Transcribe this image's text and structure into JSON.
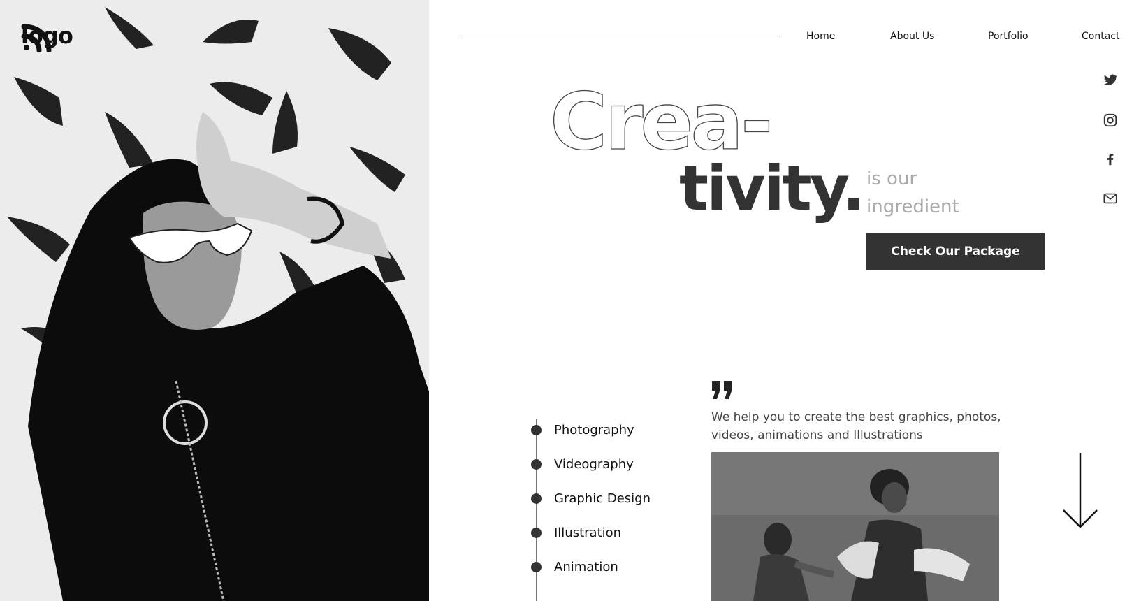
{
  "brand": {
    "logo_text": "logo"
  },
  "nav": {
    "items": [
      {
        "label": "Home"
      },
      {
        "label": "About Us"
      },
      {
        "label": "Portfolio"
      },
      {
        "label": "Contact"
      }
    ]
  },
  "social": [
    "twitter-icon",
    "instagram-icon",
    "facebook-icon",
    "mail-icon"
  ],
  "hero": {
    "word_part1": "Crea-",
    "word_part2": "tivity.",
    "tagline_line1": "is our",
    "tagline_line2": "ingredient",
    "cta_label": "Check Our Package"
  },
  "services": {
    "items": [
      "Photography",
      "Videography",
      "Graphic Design",
      "Illustration",
      "Animation"
    ]
  },
  "quote": {
    "text": "We help you to create the best graphics, photos, videos, animations and Illustrations"
  },
  "colors": {
    "dark": "#333333",
    "muted": "#aaaaaa",
    "background": "#ffffff"
  }
}
